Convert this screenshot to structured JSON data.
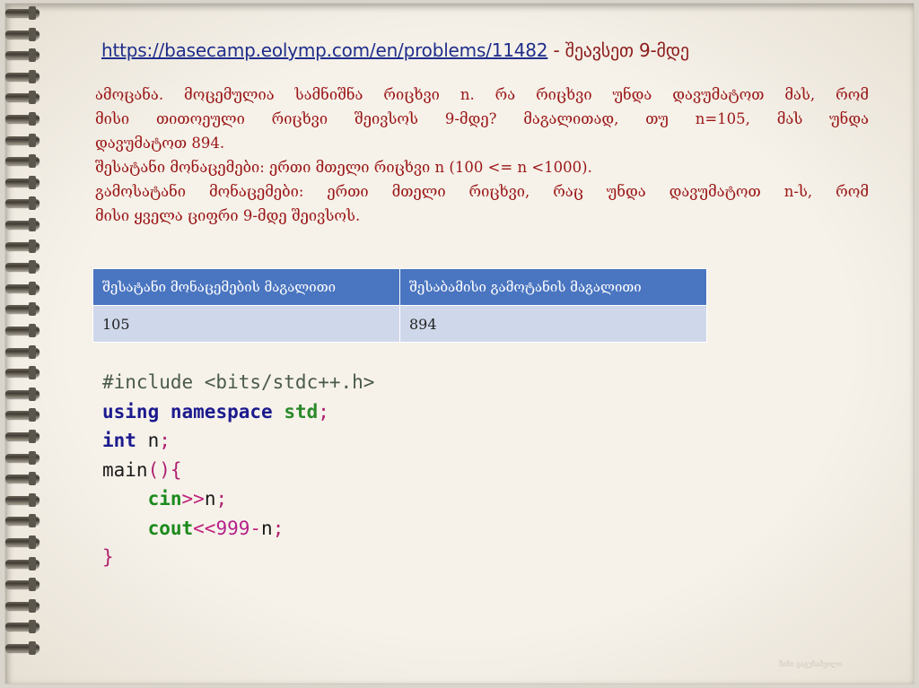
{
  "title": {
    "link_text": "https://basecamp.eolymp.com/en/problems/11482",
    "rest": " - შეავსეთ 9-მდე"
  },
  "description": {
    "line1": "ამოცანა. მოცემულია სამნიშნა რიცხვი n. რა რიცხვი უნდა დავუმატოთ მას, რომ",
    "line2": "მისი თითოეული რიცხვი შეივსოს 9-მდე? მაგალითად, თუ n=105, მას უნდა",
    "line3": "დავუმატოთ 894.",
    "line4": "შესატანი მონაცემები: ერთი მთელი რიცხვი n (100 <= n <1000).",
    "line5": "გამოსატანი მონაცემები: ერთი მთელი რიცხვი, რაც უნდა დავუმატოთ n-ს, რომ",
    "line6": "მისი ყველა ციფრი 9-მდე შეივსოს."
  },
  "table": {
    "headers": [
      "შესატანი მონაცემების მაგალითი",
      "შესაბამისი გამოტანის მაგალითი"
    ],
    "rows": [
      [
        "105",
        "894"
      ]
    ]
  },
  "code": {
    "include": "#include <bits/stdc++.h>",
    "using": "using",
    "namespace": "namespace",
    "std": "std",
    "semi": ";",
    "int": "int",
    "n_decl": " n",
    "main": "main",
    "main_paren": "()",
    "open_brace": "{",
    "cin": "cin",
    "shr": ">>",
    "n1": "n",
    "cout": "cout",
    "shl": "<<",
    "nine": "999",
    "minus": "-",
    "n2": "n",
    "close_brace": "}"
  },
  "watermark": "ზიზი გაგუნაშვილი"
}
